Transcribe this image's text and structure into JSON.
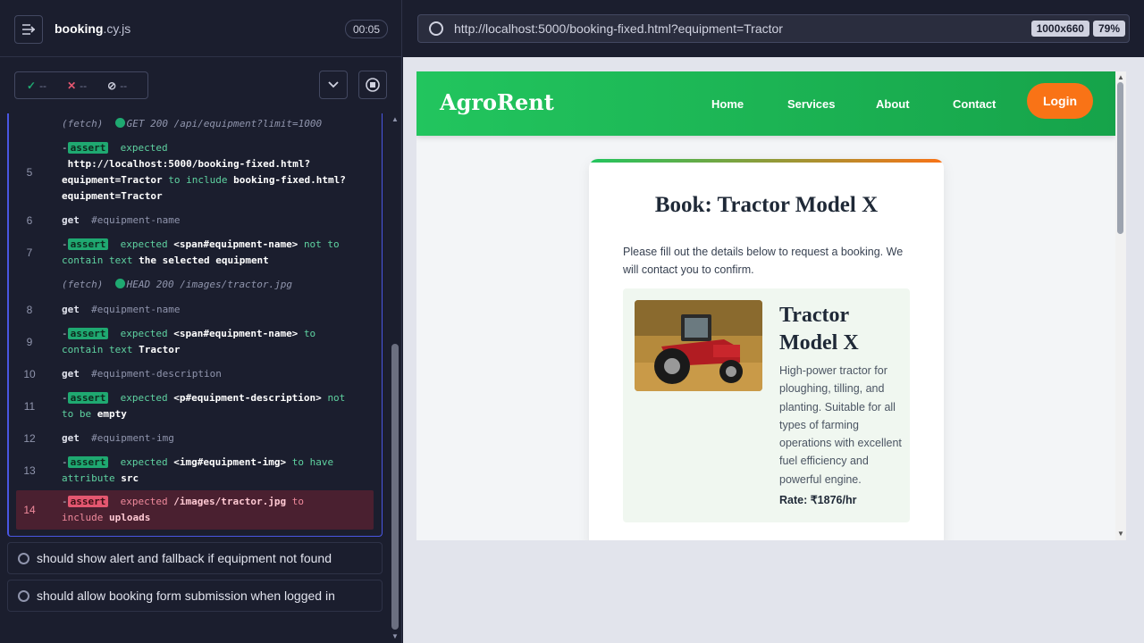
{
  "runner": {
    "spec_name": "booking",
    "spec_ext": ".cy.js",
    "timer": "00:05",
    "stats": {
      "passed": "--",
      "failed": "--",
      "pending": "--"
    }
  },
  "commands": [
    {
      "num": "",
      "type": "fetch",
      "prefix": "(fetch)",
      "text": "GET 200 /api/equipment?limit=1000"
    },
    {
      "num": "5",
      "type": "assert",
      "line1": "expected",
      "line2": "http://localhost:5000/booking-fixed.html?",
      "line3a": "equipment=Tractor",
      "line3b": "to include",
      "line3c": "booking-fixed.html?",
      "line4": "equipment=Tractor"
    },
    {
      "num": "6",
      "cmd": "get",
      "arg": "#equipment-name"
    },
    {
      "num": "7",
      "type": "assert",
      "l1a": "expected",
      "l1b": "<span#equipment-name>",
      "l1c": "not to",
      "l2a": "contain text",
      "l2b": "the selected equipment"
    },
    {
      "num": "",
      "type": "fetch",
      "prefix": "(fetch)",
      "text": "HEAD 200 /images/tractor.jpg"
    },
    {
      "num": "8",
      "cmd": "get",
      "arg": "#equipment-name"
    },
    {
      "num": "9",
      "type": "assert",
      "l1a": "expected",
      "l1b": "<span#equipment-name>",
      "l1c": "to",
      "l2a": "contain text",
      "l2b": "Tractor"
    },
    {
      "num": "10",
      "cmd": "get",
      "arg": "#equipment-description"
    },
    {
      "num": "11",
      "type": "assert",
      "l1a": "expected",
      "l1b": "<p#equipment-description>",
      "l1c": "not",
      "l2a": "to be",
      "l2b": "empty"
    },
    {
      "num": "12",
      "cmd": "get",
      "arg": "#equipment-img"
    },
    {
      "num": "13",
      "type": "assert",
      "l1a": "expected",
      "l1b": "<img#equipment-img>",
      "l1c": "to have",
      "l2a": "attribute",
      "l2b": "src"
    },
    {
      "num": "14",
      "type": "assert-fail",
      "l1a": "expected",
      "l1b": "/images/tractor.jpg",
      "l1c": "to",
      "l2a": "include",
      "l2b": "uploads"
    }
  ],
  "assert_label": "assert",
  "tests": [
    "should show alert and fallback if equipment not found",
    "should allow booking form submission when logged in"
  ],
  "browser": {
    "url": "http://localhost:5000/booking-fixed.html?equipment=Tractor",
    "viewport": "1000x660",
    "zoom": "79%"
  },
  "site": {
    "brand": "AgroRent",
    "nav": [
      "Home",
      "Services",
      "About",
      "Contact"
    ],
    "login": "Login",
    "heading": "Book: Tractor Model X",
    "intro": "Please fill out the details below to request a booking. We will contact you to confirm.",
    "equipment_name": "Tractor Model X",
    "equipment_description": "High-power tractor for ploughing, tilling, and planting. Suitable for all types of farming operations with excellent fuel efficiency and powerful engine.",
    "rate": "Rate: ₹1876/hr"
  },
  "colors": {
    "accent": "#4956e3",
    "pass": "#1fa971",
    "fail": "#e45770",
    "brand_green": "#22c55e",
    "login_orange": "#f97316"
  }
}
